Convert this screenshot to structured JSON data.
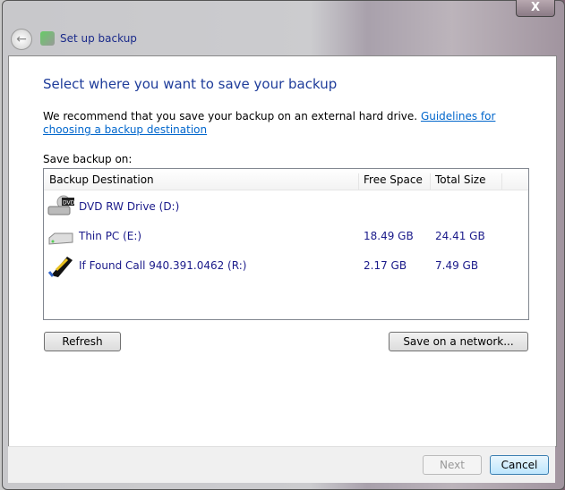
{
  "window": {
    "title": "Set up backup",
    "close_label": "X"
  },
  "heading": "Select where you want to save your backup",
  "recommendation": "We recommend that you save your backup on an external hard drive.",
  "guidelines_link": "Guidelines for choosing a backup destination",
  "save_on_label": "Save backup on:",
  "table": {
    "columns": [
      "Backup Destination",
      "Free Space",
      "Total Size"
    ],
    "rows": [
      {
        "name": "DVD RW Drive (D:)",
        "free": "",
        "total": "",
        "icon": "dvd-drive-icon"
      },
      {
        "name": "Thin PC (E:)",
        "free": "18.49 GB",
        "total": "24.41 GB",
        "icon": "hard-drive-icon"
      },
      {
        "name": "If Found Call 940.391.0462 (R:)",
        "free": "2.17 GB",
        "total": "7.49 GB",
        "icon": "usb-drive-icon"
      }
    ]
  },
  "buttons": {
    "refresh": "Refresh",
    "network": "Save on a network...",
    "next": "Next",
    "cancel": "Cancel"
  }
}
